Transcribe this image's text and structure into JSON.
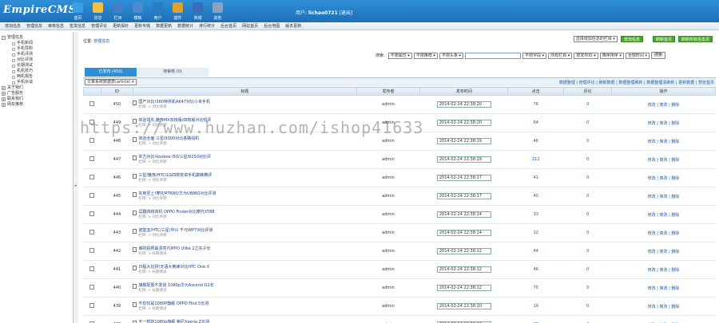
{
  "header": {
    "logo": "EmpireCMS",
    "nav": [
      {
        "label": "首页",
        "icon": "home-icon",
        "color": "#3aa0e8"
      },
      {
        "label": "信息",
        "icon": "note-icon",
        "color": "#f5c040"
      },
      {
        "label": "栏目",
        "icon": "folder-icon",
        "color": "#3f7fc8"
      },
      {
        "label": "模板",
        "icon": "template-icon",
        "color": "#4c8ad0"
      },
      {
        "label": "用户",
        "icon": "user-icon",
        "color": "#2a7ac4"
      },
      {
        "label": "插件",
        "icon": "plugin-icon",
        "color": "#e0a030"
      },
      {
        "label": "商城",
        "icon": "shop-icon",
        "color": "#3a6ab8"
      },
      {
        "label": "其他",
        "icon": "gear-icon",
        "color": "#8aa2c0"
      }
    ],
    "user_prefix": "用户:",
    "user_name": "lichao0721",
    "logout": "[退出]"
  },
  "menubar": [
    "增加信息",
    "管理信息",
    "审核信息",
    "签发信息",
    "管理评论",
    "更新探针",
    "更新专题",
    "数据更新",
    "数据统计",
    "排行统计",
    "后台首页",
    "网站首页",
    "后台地图",
    "版本更新"
  ],
  "sidebar": {
    "root": "管理信息",
    "items": [
      "手机新闻",
      "手机导购",
      "手机评测",
      "对比评测",
      "长期测试",
      "机机技巧",
      "两机报告",
      "手机杂谈"
    ],
    "groups": [
      "关于我们",
      "广告服务",
      "联系我们",
      "网友推荐"
    ]
  },
  "main": {
    "position_label": "位置:",
    "position_link": "管理信息",
    "column_select": "选择增加信息的栏目",
    "btn_add": "增加信息",
    "btn_refresh": "刷新首页",
    "btn_refresh_all": "刷新所有信息页",
    "search_label": "搜索:",
    "search_filters": [
      "不限属性",
      "不限推荐",
      "不限头条"
    ],
    "search_field": "不限字段",
    "search_col": "所有栏目",
    "search_order": "按发布ID",
    "search_sort": "降序排序",
    "search_type": "全部时间",
    "search_btn": "搜索",
    "tab_published": "已发布 (450)",
    "tab_pending": "待审核 (0)",
    "table_select": "文章系统数据表(article)",
    "quick_links": "数据整理 | 管理评论 | 刷新数据 | 数据整理刷新 | 数据整理清刷新 | 更新数据 | 预览首页",
    "columns": [
      "",
      "ID",
      "标题",
      "发布者",
      "发布时间",
      "点击",
      "评论",
      "操作"
    ]
  },
  "rows": [
    {
      "id": "450",
      "title": "国产对比!360特供机AK47对比小米手机",
      "cat": "栏目: > 对比评测",
      "author": "admin",
      "time": "2014-02-24 22:38:20",
      "clicks": "76",
      "comments": "0",
      "ops": "修改 | 简改 | 删除"
    },
    {
      "id": "449",
      "title": "体验领先,魅族MX双核版/四核版对比短评",
      "cat": "栏目: > 对比评测",
      "author": "admin",
      "time": "2014-02-24 22:38:20",
      "clicks": "64",
      "comments": "0",
      "ops": "修改 | 简改 | 删除"
    },
    {
      "id": "448",
      "title": "体验全面 三星I9300对比各路强机",
      "cat": "栏目: > 对比评测",
      "author": "admin",
      "time": "2014-02-24 22:38:19",
      "clicks": "46",
      "comments": "0",
      "ops": "修改 | 简改 | 删除"
    },
    {
      "id": "447",
      "title": "实力对比!koobee I50/三星I9250对比评",
      "cat": "栏目: > 对比评测",
      "author": "admin",
      "time": "2014-02-24 22:38:19",
      "clicks": "212",
      "comments": "0",
      "ops": "修改 | 简改 | 删除"
    },
    {
      "id": "446",
      "title": "三星/魅族/HTC/LG四核安卓手机巅峰横评",
      "cat": "栏目: > 对比评测",
      "author": "admin",
      "time": "2014-02-24 22:38:17",
      "clicks": "41",
      "comments": "0",
      "ops": "修改 | 简改 | 删除"
    },
    {
      "id": "445",
      "title": "实用至上!摩托MT680/华为U8860对比评测",
      "cat": "栏目: > 对比评测",
      "author": "admin",
      "time": "2014-02-24 22:38:17",
      "clicks": "40",
      "comments": "0",
      "ops": "修改 | 简改 | 删除"
    },
    {
      "id": "444",
      "title": "逗翻四核四机 OPPO Finder对比摩托XT88",
      "cat": "栏目: > 对比评测",
      "author": "admin",
      "time": "2014-02-24 22:38:14",
      "clicks": "33",
      "comments": "0",
      "ops": "修改 | 简改 | 删除"
    },
    {
      "id": "443",
      "title": "诺基亚/HTC/三星/中兴 千元WP7对比评测",
      "cat": "栏目: > 对比评测",
      "author": "admin",
      "time": "2014-02-24 22:38:14",
      "clicks": "12",
      "comments": "0",
      "ops": "修改 | 简改 | 删除"
    },
    {
      "id": "442",
      "title": "谁的拍照最漂亮?OPPO Ulike 2之先子长",
      "cat": "栏目: > 长期测试",
      "author": "admin",
      "time": "2014-02-24 22:38:12",
      "clicks": "44",
      "comments": "0",
      "ops": "修改 | 简改 | 删除"
    },
    {
      "id": "441",
      "title": "日程大比拼!天语大黄蜂对比HTC One X",
      "cat": "栏目: > 长期测试",
      "author": "admin",
      "time": "2014-02-24 22:38:12",
      "clicks": "46",
      "comments": "0",
      "ops": "修改 | 简改 | 删除"
    },
    {
      "id": "440",
      "title": "旗舰配置不发烧 1080p华为Ascend D2长",
      "cat": "栏目: > 长期测试",
      "author": "admin",
      "time": "2014-02-24 22:38:12",
      "clicks": "70",
      "comments": "0",
      "ops": "修改 | 简改 | 删除"
    },
    {
      "id": "439",
      "title": "不仅仅是1080P旗舰 OPPO Find 5长测",
      "cat": "栏目: > 长期测试",
      "author": "admin",
      "time": "2014-02-24 22:38:10",
      "clicks": "19",
      "comments": "0",
      "ops": "修改 | 简改 | 删除"
    },
    {
      "id": "438",
      "title": "不一样的1080p旗舰 索尼Xperia Z长测",
      "cat": "栏目: > 长期测试",
      "author": "admin",
      "time": "2014-02-24 22:38:10",
      "clicks": "28",
      "comments": "0",
      "ops": "修改 | 简改 | 删除"
    }
  ],
  "watermark": "https://www.huzhan.com/ishop41633"
}
